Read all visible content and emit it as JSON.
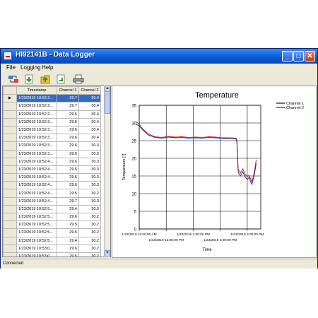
{
  "window": {
    "title": "HI92141B - Data Logger"
  },
  "menu": [
    "File",
    "Logging",
    "Help"
  ],
  "toolbar": {
    "icons": [
      "connect-icon",
      "download-icon",
      "export-icon",
      "save-icon",
      "print-icon"
    ]
  },
  "table": {
    "headers": {
      "timestamp": "Timestamp",
      "ch1": "Channel 1",
      "ch2": "Channel 2"
    },
    "row_marker": "▶",
    "rows": [
      {
        "ts": "1/23/2019 10:52:2...",
        "c1": "29.7",
        "c2": "30.4"
      },
      {
        "ts": "1/23/2019 10:52:2...",
        "c1": "29.7",
        "c2": "30.4"
      },
      {
        "ts": "1/23/2019 10:52:2...",
        "c1": "29.6",
        "c2": "30.4"
      },
      {
        "ts": "1/23/2019 10:52:3...",
        "c1": "29.6",
        "c2": "30.4"
      },
      {
        "ts": "1/23/2019 10:52:3...",
        "c1": "29.6",
        "c2": "30.4"
      },
      {
        "ts": "1/23/2019 10:52:3...",
        "c1": "29.6",
        "c2": "30.4"
      },
      {
        "ts": "1/23/2019 10:52:3...",
        "c1": "29.6",
        "c2": "30.3"
      },
      {
        "ts": "1/23/2019 10:52:3...",
        "c1": "29.6",
        "c2": "30.3"
      },
      {
        "ts": "1/23/2019 10:52:4...",
        "c1": "29.6",
        "c2": "30.3"
      },
      {
        "ts": "1/23/2019 10:52:4...",
        "c1": "29.5",
        "c2": "30.3"
      },
      {
        "ts": "1/23/2019 10:52:4...",
        "c1": "29.6",
        "c2": "30.3"
      },
      {
        "ts": "1/23/2019 10:52:4...",
        "c1": "29.6",
        "c2": "30.3"
      },
      {
        "ts": "1/23/2019 10:52:4...",
        "c1": "29.5",
        "c2": "30.2"
      },
      {
        "ts": "1/23/2019 10:52:4...",
        "c1": "29.7",
        "c2": "30.3"
      },
      {
        "ts": "1/23/2019 10:52:5...",
        "c1": "29.4",
        "c2": "30.3"
      },
      {
        "ts": "1/23/2019 10:52:5...",
        "c1": "29.6",
        "c2": "30.2"
      },
      {
        "ts": "1/23/2019 10:52:5...",
        "c1": "29.5",
        "c2": "30.2"
      },
      {
        "ts": "1/23/2019 10:52:5...",
        "c1": "29.5",
        "c2": "30.2"
      },
      {
        "ts": "1/23/2019 10:52:5...",
        "c1": "29.4",
        "c2": "30.2"
      },
      {
        "ts": "1/23/2019 10:53:0...",
        "c1": "29.6",
        "c2": "30.2"
      },
      {
        "ts": "1/23/2019 10:53:0...",
        "c1": "29.5",
        "c2": "30.2"
      }
    ]
  },
  "status": {
    "text": "Connected"
  },
  "colors": {
    "channel1": "#2233aa",
    "channel2": "#cc2222",
    "selection": "#316ac5"
  },
  "chart_data": {
    "type": "line",
    "title": "Temperature",
    "xlabel": "Time",
    "ylabel": "Temperature [°]",
    "ylim": [
      0,
      35
    ],
    "yticks": [
      0,
      5,
      10,
      15,
      20,
      25,
      30,
      35
    ],
    "xlim": [
      "1/23/2019 11:00:00 AM",
      "1/23/2019 3:30:00 PM"
    ],
    "xticks": [
      {
        "x": "1/23/2019 11:00:00 AM",
        "label": "1/23/2019 11:00:00 AM",
        "row": 0
      },
      {
        "x": "1/23/2019 12:00:00 PM",
        "label": "1/23/2019 12:00:00 PM",
        "row": 1
      },
      {
        "x": "1/23/2019 1:00:00 PM",
        "label": "1/23/2019 1:00:00 PM",
        "row": 0
      },
      {
        "x": "1/23/2019 2:00:00 PM",
        "label": "1/23/2019 2:00:00 PM",
        "row": 1
      },
      {
        "x": "1/23/2019 3:00:00 PM",
        "label": "1/23/2019 3:00:00 PM",
        "row": 0
      }
    ],
    "grid": true,
    "legend": "top-right",
    "series": [
      {
        "name": "Channel 1",
        "points": [
          [
            "1/23/2019 10:53:00 AM",
            29.6
          ],
          [
            "1/23/2019 11:00:00 AM",
            29.2
          ],
          [
            "1/23/2019 11:08:00 AM",
            28.0
          ],
          [
            "1/23/2019 11:20:00 AM",
            26.6
          ],
          [
            "1/23/2019 11:35:00 AM",
            25.9
          ],
          [
            "1/23/2019 11:50:00 AM",
            25.7
          ],
          [
            "1/23/2019 12:05:00 PM",
            26.0
          ],
          [
            "1/23/2019 12:20:00 PM",
            25.8
          ],
          [
            "1/23/2019 12:35:00 PM",
            25.9
          ],
          [
            "1/23/2019 12:50:00 PM",
            25.7
          ],
          [
            "1/23/2019 1:05:00 PM",
            25.8
          ],
          [
            "1/23/2019 1:20:00 PM",
            25.7
          ],
          [
            "1/23/2019 1:35:00 PM",
            25.9
          ],
          [
            "1/23/2019 1:50:00 PM",
            25.8
          ],
          [
            "1/23/2019 2:05:00 PM",
            25.6
          ],
          [
            "1/23/2019 2:20:00 PM",
            25.6
          ],
          [
            "1/23/2019 2:35:00 PM",
            25.5
          ],
          [
            "1/23/2019 2:37:00 PM",
            24.5
          ],
          [
            "1/23/2019 2:40:00 PM",
            16.0
          ],
          [
            "1/23/2019 2:45:00 PM",
            15.0
          ],
          [
            "1/23/2019 2:50:00 PM",
            16.2
          ],
          [
            "1/23/2019 2:55:00 PM",
            14.8
          ],
          [
            "1/23/2019 3:00:00 PM",
            14.0
          ],
          [
            "1/23/2019 3:04:00 PM",
            14.6
          ],
          [
            "1/23/2019 3:08:00 PM",
            13.2
          ],
          [
            "1/23/2019 3:10:00 PM",
            12.6
          ],
          [
            "1/23/2019 3:13:00 PM",
            14.0
          ],
          [
            "1/23/2019 3:16:00 PM",
            15.6
          ],
          [
            "1/23/2019 3:20:00 PM",
            18.6
          ]
        ]
      },
      {
        "name": "Channel 2",
        "points": [
          [
            "1/23/2019 10:53:00 AM",
            30.3
          ],
          [
            "1/23/2019 11:00:00 AM",
            29.7
          ],
          [
            "1/23/2019 11:08:00 AM",
            28.3
          ],
          [
            "1/23/2019 11:20:00 AM",
            26.9
          ],
          [
            "1/23/2019 11:35:00 AM",
            26.1
          ],
          [
            "1/23/2019 11:50:00 AM",
            25.9
          ],
          [
            "1/23/2019 12:05:00 PM",
            26.2
          ],
          [
            "1/23/2019 12:20:00 PM",
            26.0
          ],
          [
            "1/23/2019 12:35:00 PM",
            26.1
          ],
          [
            "1/23/2019 12:50:00 PM",
            25.9
          ],
          [
            "1/23/2019 1:05:00 PM",
            26.0
          ],
          [
            "1/23/2019 1:20:00 PM",
            25.9
          ],
          [
            "1/23/2019 1:35:00 PM",
            26.1
          ],
          [
            "1/23/2019 1:50:00 PM",
            26.0
          ],
          [
            "1/23/2019 2:05:00 PM",
            25.8
          ],
          [
            "1/23/2019 2:20:00 PM",
            25.8
          ],
          [
            "1/23/2019 2:35:00 PM",
            25.7
          ],
          [
            "1/23/2019 2:37:00 PM",
            25.0
          ],
          [
            "1/23/2019 2:40:00 PM",
            16.8
          ],
          [
            "1/23/2019 2:45:00 PM",
            15.8
          ],
          [
            "1/23/2019 2:50:00 PM",
            17.0
          ],
          [
            "1/23/2019 2:55:00 PM",
            15.6
          ],
          [
            "1/23/2019 3:00:00 PM",
            14.8
          ],
          [
            "1/23/2019 3:04:00 PM",
            15.2
          ],
          [
            "1/23/2019 3:08:00 PM",
            14.0
          ],
          [
            "1/23/2019 3:10:00 PM",
            13.4
          ],
          [
            "1/23/2019 3:13:00 PM",
            14.6
          ],
          [
            "1/23/2019 3:16:00 PM",
            16.4
          ],
          [
            "1/23/2019 3:20:00 PM",
            19.6
          ]
        ]
      }
    ]
  }
}
